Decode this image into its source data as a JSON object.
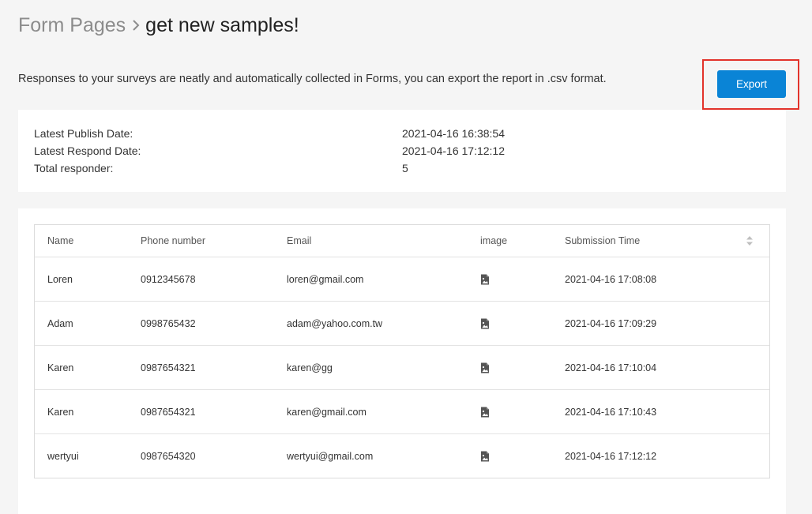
{
  "breadcrumb": {
    "parent": "Form Pages",
    "current": "get new samples!"
  },
  "description": "Responses to your surveys are neatly and automatically collected in Forms, you can export the report in .csv format.",
  "export_button": {
    "label": "Export"
  },
  "summary": [
    {
      "label": "Latest Publish Date:",
      "value": "2021-04-16 16:38:54"
    },
    {
      "label": "Latest Respond Date:",
      "value": "2021-04-16 17:12:12"
    },
    {
      "label": "Total responder:",
      "value": "5"
    }
  ],
  "table": {
    "columns": [
      "Name",
      "Phone number",
      "Email",
      "image",
      "Submission Time"
    ],
    "rows": [
      {
        "name": "Loren",
        "phone": "0912345678",
        "email": "loren@gmail.com",
        "time": "2021-04-16 17:08:08"
      },
      {
        "name": "Adam",
        "phone": "0998765432",
        "email": "adam@yahoo.com.tw",
        "time": "2021-04-16 17:09:29"
      },
      {
        "name": "Karen",
        "phone": "0987654321",
        "email": "karen@gg",
        "time": "2021-04-16 17:10:04"
      },
      {
        "name": "Karen",
        "phone": "0987654321",
        "email": "karen@gmail.com",
        "time": "2021-04-16 17:10:43"
      },
      {
        "name": "wertyui",
        "phone": "0987654320",
        "email": "wertyui@gmail.com",
        "time": "2021-04-16 17:12:12"
      }
    ]
  },
  "colors": {
    "accent": "#0a84d6",
    "highlight": "#e2332b",
    "background": "#f5f5f5"
  },
  "icons": {
    "breadcrumb_separator": "chevron-right-icon",
    "image_cell": "image-file-icon",
    "sort": "sort-icon"
  }
}
